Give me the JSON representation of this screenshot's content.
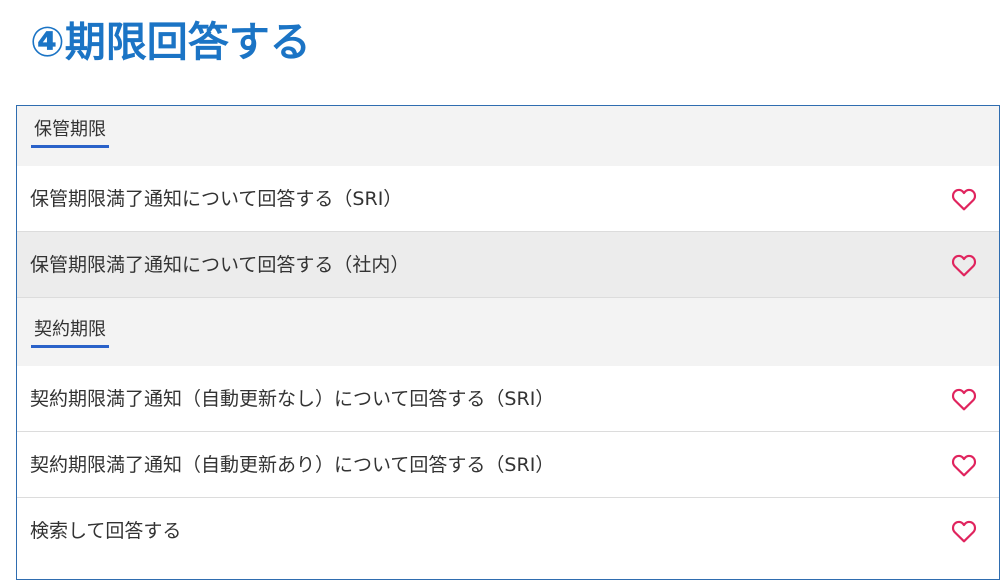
{
  "page": {
    "title": "④期限回答する"
  },
  "colors": {
    "title": "#1b74c5",
    "accent_underline": "#2a62c9",
    "panel_border": "#2f6db0",
    "heart": "#e0245e",
    "section_bg": "#f3f3f3",
    "hover_bg": "#ececec"
  },
  "sections": [
    {
      "label": "保管期限",
      "items": [
        {
          "label": "保管期限満了通知について回答する（SRI）",
          "icon": "heart-outline-icon"
        },
        {
          "label": "保管期限満了通知について回答する（社内）",
          "icon": "heart-outline-icon"
        }
      ]
    },
    {
      "label": "契約期限",
      "items": [
        {
          "label": "契約期限満了通知（自動更新なし）について回答する（SRI）",
          "icon": "heart-outline-icon"
        },
        {
          "label": "契約期限満了通知（自動更新あり）について回答する（SRI）",
          "icon": "heart-outline-icon"
        },
        {
          "label": "検索して回答する",
          "icon": "heart-outline-icon"
        }
      ]
    }
  ]
}
